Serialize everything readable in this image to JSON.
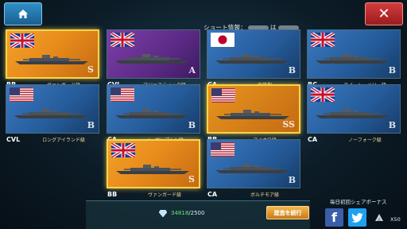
{
  "header": {
    "home_icon": "home-icon",
    "close_icon": "close-icon",
    "close_glyph": "✕",
    "share_info_prefix": "ショート情報：",
    "share_info_mid": "は"
  },
  "cards": [
    {
      "type": "BB",
      "name": "ヴァンガード級",
      "rank": "S",
      "flag": "uk",
      "bg": "r-bb-gold"
    },
    {
      "type": "CVL",
      "name": "マジェスティック級",
      "rank": "A",
      "flag": "uk",
      "bg": "purple"
    },
    {
      "type": "CA",
      "name": "高雄型",
      "rank": "B",
      "flag": "jp",
      "bg": "blue"
    },
    {
      "type": "BC",
      "name": "クイーン・メリー級",
      "rank": "B",
      "flag": "uk",
      "bg": "blue"
    },
    {
      "type": "CVL",
      "name": "ロングアイランド級",
      "rank": "B",
      "flag": "us",
      "bg": "blue"
    },
    {
      "type": "CA",
      "name": "ノーザンプトン級",
      "rank": "B",
      "flag": "us",
      "bg": "blue"
    },
    {
      "type": "BB",
      "name": "アイオワ級",
      "rank": "SS",
      "flag": "us",
      "bg": "gold-frame"
    },
    {
      "type": "CA",
      "name": "ノーフォーク級",
      "rank": "B",
      "flag": "uk",
      "bg": "blue"
    },
    {
      "type": "BB",
      "name": "ヴァンガード級",
      "rank": "S",
      "flag": "uk",
      "bg": "r-bb-gold"
    },
    {
      "type": "CA",
      "name": "ボルチモア級",
      "rank": "B",
      "flag": "us",
      "bg": "blue"
    }
  ],
  "bottom": {
    "currency_icon": "diamond-icon",
    "currency_value": "34818",
    "currency_sep": "/2500",
    "build_button": "建造を続行",
    "bonus_label": "毎日初回シェアボーナス",
    "facebook_glyph": "f",
    "bonus_multiplier": "X50"
  },
  "colors": {
    "gold": "#f8d44a",
    "purple": "#7c3fa8",
    "blue": "#3a79c0",
    "home_button": "#2f8fc7",
    "close_button": "#d33c3c",
    "build_button": "#f2b84c"
  }
}
